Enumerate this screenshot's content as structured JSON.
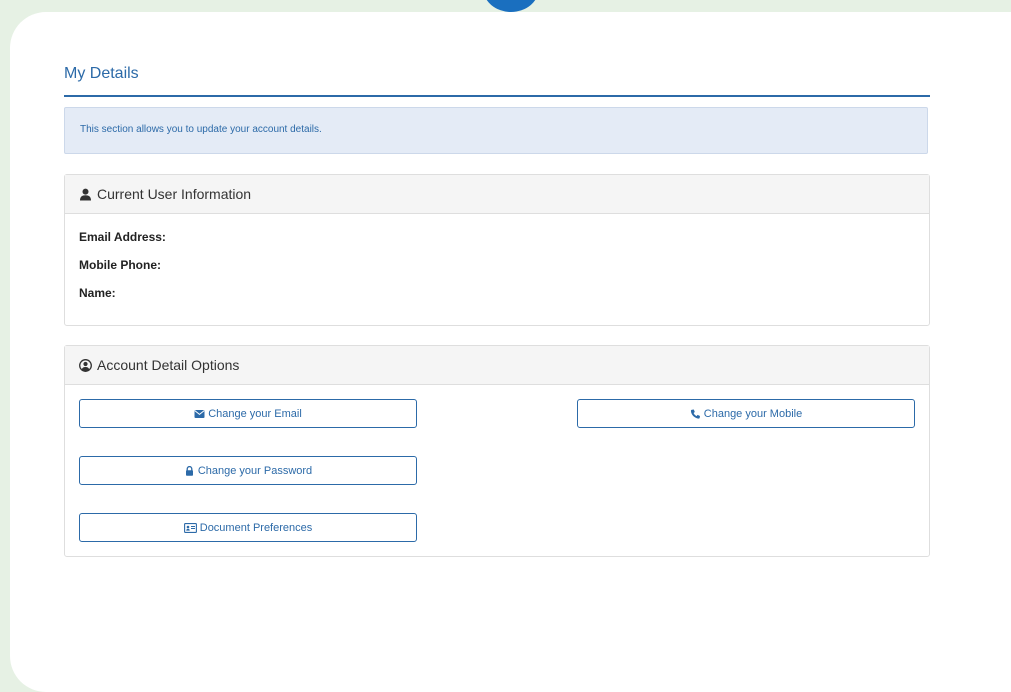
{
  "page": {
    "title": "My Details",
    "info_text": "This section allows you to update your account details."
  },
  "user_panel": {
    "heading": "Current User Information",
    "icon": "user-icon",
    "fields": [
      {
        "label": "Email Address:",
        "value": ""
      },
      {
        "label": "Mobile Phone:",
        "value": ""
      },
      {
        "label": "Name:",
        "value": ""
      }
    ]
  },
  "options_panel": {
    "heading": "Account Detail Options",
    "icon": "user-circle-icon",
    "buttons": {
      "change_email": {
        "label": "Change your Email",
        "icon": "envelope-icon"
      },
      "change_mobile": {
        "label": "Change your Mobile",
        "icon": "phone-icon"
      },
      "change_password": {
        "label": "Change your Password",
        "icon": "lock-icon"
      },
      "document_preferences": {
        "label": "Document Preferences",
        "icon": "id-card-icon"
      }
    }
  },
  "colors": {
    "accent": "#2c6aa8",
    "background": "#e6f1e4",
    "alert_bg": "#e4ebf6"
  }
}
